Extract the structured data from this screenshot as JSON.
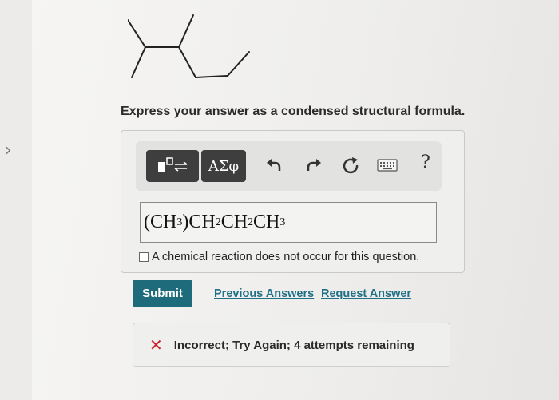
{
  "prompt": "Express your answer as a condensed structural formula.",
  "toolbar": {
    "template_icon": "template-icon",
    "greek_label": "ΑΣφ",
    "undo_icon": "undo-icon",
    "redo_icon": "redo-icon",
    "reset_icon": "reset-icon",
    "keyboard_icon": "keyboard-icon",
    "help_label": "?"
  },
  "answer": {
    "p1": "(CH",
    "s1": "3",
    "p2": " )CH",
    "s2": "2",
    "p3": " CH",
    "s3": "2",
    "p4": " CH",
    "s4": "3"
  },
  "no_reaction_label": "A chemical reaction does not occur for this question.",
  "submit_label": "Submit",
  "previous_answers_label": "Previous Answers",
  "request_answer_label": "Request Answer",
  "feedback_text": "Incorrect; Try Again; 4 attempts remaining",
  "colors": {
    "submit_bg": "#1e6b7b",
    "link": "#1f6f86",
    "error": "#c8202a"
  }
}
